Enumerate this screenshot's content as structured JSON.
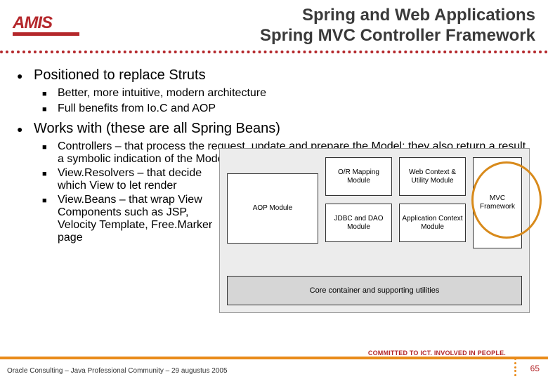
{
  "logo": {
    "text": "AMIS"
  },
  "title": {
    "line1": "Spring and Web Applications",
    "line2": "Spring MVC Controller Framework"
  },
  "bullets": {
    "b1": "Positioned to replace Struts",
    "b1_1": "Better, more intuitive, modern architecture",
    "b1_2": "Full benefits from Io.C and AOP",
    "b2": "Works with (these are all Spring Beans)",
    "b2_1": "Controllers – that process the request, update and prepare the Model; they also return a result, a symbolic indication of the Model.View to proceed to",
    "b2_2": "View.Resolvers – that decide which View to let render",
    "b2_3": "View.Beans – that wrap View Components such as JSP, Velocity Template, Free.Marker page"
  },
  "diagram": {
    "aop": "AOP Module",
    "orm": "O/R Mapping Module",
    "web": "Web Context & Utility Module",
    "mvc": "MVC Framework",
    "jdbc": "JDBC and DAO Module",
    "appctx": "Application Context Module",
    "core": "Core container and supporting utilities"
  },
  "footer": {
    "text": "Oracle Consulting – Java Professional Community – 29 augustus 2005",
    "tagline": "COMMITTED TO ICT. INVOLVED IN PEOPLE.",
    "page": "65"
  }
}
